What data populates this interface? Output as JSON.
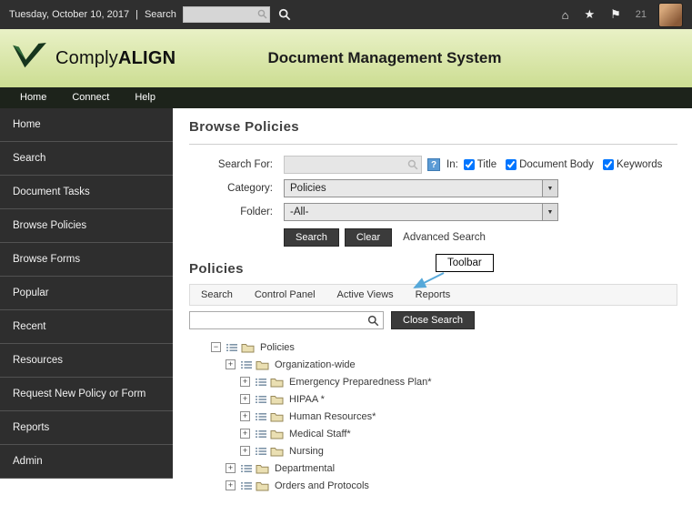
{
  "topbar": {
    "date": "Tuesday, October 10, 2017",
    "divider": "|",
    "search_label": "Search",
    "search_value": "",
    "notification_count": "21"
  },
  "icons": {
    "home_glyph": "⌂",
    "star_glyph": "★",
    "flag_glyph": "⚑",
    "dropdown_glyph": "▼",
    "help_glyph": "?"
  },
  "header": {
    "logo_text_1": "Comply",
    "logo_text_2": "ALIGN",
    "title": "Document Management System"
  },
  "nav": {
    "items": [
      {
        "label": "Home"
      },
      {
        "label": "Connect"
      },
      {
        "label": "Help"
      }
    ]
  },
  "sidebar": {
    "items": [
      {
        "label": "Home"
      },
      {
        "label": "Search"
      },
      {
        "label": "Document Tasks"
      },
      {
        "label": "Browse Policies"
      },
      {
        "label": "Browse Forms"
      },
      {
        "label": "Popular"
      },
      {
        "label": "Recent"
      },
      {
        "label": "Resources"
      },
      {
        "label": "Request New Policy or Form"
      },
      {
        "label": "Reports"
      },
      {
        "label": "Admin"
      }
    ]
  },
  "browse": {
    "title": "Browse Policies",
    "search_for_label": "Search For:",
    "search_value": "",
    "in_label": "In:",
    "filters": [
      {
        "label": "Title",
        "checked": true
      },
      {
        "label": "Document Body",
        "checked": true
      },
      {
        "label": "Keywords",
        "checked": true
      }
    ],
    "category_label": "Category:",
    "category_value": "Policies",
    "folder_label": "Folder:",
    "folder_value": "-All-",
    "search_button": "Search",
    "clear_button": "Clear",
    "advanced_search": "Advanced Search"
  },
  "policies": {
    "title": "Policies",
    "callout_label": "Toolbar",
    "toolbar_items": [
      {
        "label": "Search"
      },
      {
        "label": "Control Panel"
      },
      {
        "label": "Active Views"
      },
      {
        "label": "Reports"
      }
    ],
    "tree_search_value": "",
    "close_search_button": "Close Search",
    "tree": [
      {
        "label": "Policies",
        "exp": "−",
        "level": 0
      },
      {
        "label": "Organization-wide",
        "exp": "+",
        "level": 1
      },
      {
        "label": "Emergency Preparedness Plan*",
        "exp": "+",
        "level": 2
      },
      {
        "label": "HIPAA *",
        "exp": "+",
        "level": 2
      },
      {
        "label": "Human Resources*",
        "exp": "+",
        "level": 2
      },
      {
        "label": "Medical Staff*",
        "exp": "+",
        "level": 2
      },
      {
        "label": "Nursing",
        "exp": "+",
        "level": 2
      },
      {
        "label": "Departmental",
        "exp": "+",
        "level": 1
      },
      {
        "label": "Orders and Protocols",
        "exp": "+",
        "level": 1
      }
    ]
  },
  "colors": {
    "header_green": "#d8e5a4",
    "sidebar_dark": "#2e2e2e",
    "callout_arrow_blue": "#56a8d9",
    "help_icon_blue": "#5b9bd5"
  }
}
